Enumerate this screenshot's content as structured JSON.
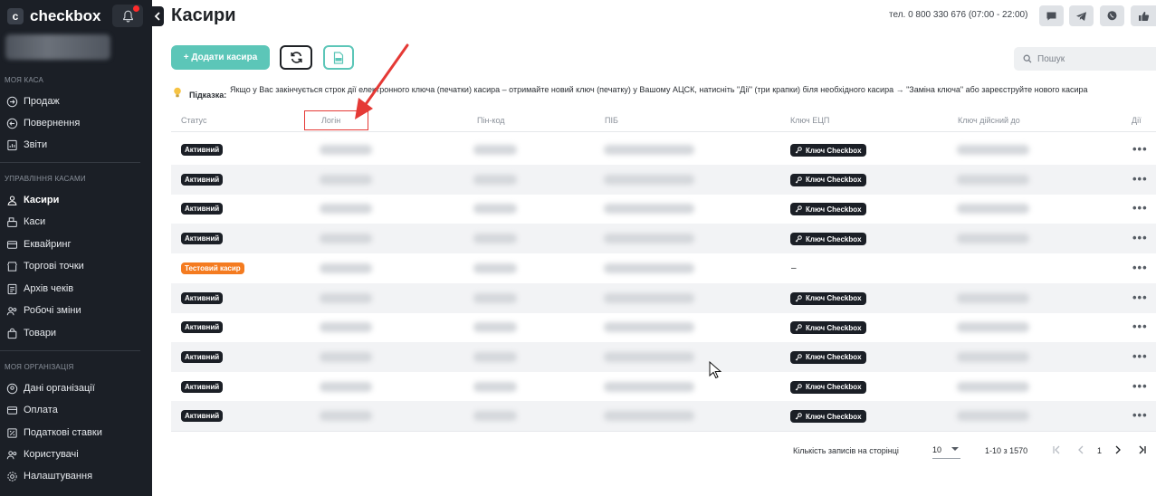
{
  "brand": {
    "name": "checkbox",
    "mark": "c"
  },
  "sidebar": {
    "sections": [
      {
        "title": "МОЯ КАСА",
        "items": [
          {
            "label": "Продаж",
            "icon": "arrow-right-circle-icon"
          },
          {
            "label": "Повернення",
            "icon": "arrow-left-circle-icon"
          },
          {
            "label": "Звіти",
            "icon": "report-icon"
          }
        ]
      },
      {
        "title": "УПРАВЛІННЯ КАСАМИ",
        "items": [
          {
            "label": "Касири",
            "icon": "cashiers-icon",
            "active": true
          },
          {
            "label": "Каси",
            "icon": "cash-register-icon"
          },
          {
            "label": "Еквайринг",
            "icon": "acquiring-icon"
          },
          {
            "label": "Торгові точки",
            "icon": "shop-icon"
          },
          {
            "label": "Архів чеків",
            "icon": "archive-icon"
          },
          {
            "label": "Робочі зміни",
            "icon": "shifts-icon"
          },
          {
            "label": "Товари",
            "icon": "bag-icon"
          }
        ]
      },
      {
        "title": "МОЯ ОРГАНІЗАЦІЯ",
        "items": [
          {
            "label": "Дані організації",
            "icon": "organization-icon"
          },
          {
            "label": "Оплата",
            "icon": "payment-icon"
          },
          {
            "label": "Податкові ставки",
            "icon": "tax-icon"
          },
          {
            "label": "Користувачі",
            "icon": "users-icon"
          },
          {
            "label": "Налаштування",
            "icon": "settings-icon"
          }
        ]
      }
    ]
  },
  "header": {
    "title": "Касири",
    "phone": "тел. 0 800 330 676 (07:00 - 22:00)",
    "icons": [
      "chat-icon",
      "telegram-icon",
      "viber-icon",
      "thumbs-up-icon"
    ]
  },
  "toolbar": {
    "add_label": "+ Додати касира",
    "search_placeholder": "Пошук"
  },
  "hint": {
    "label": "Підказка:",
    "text": "Якщо у Вас закінчується строк дії електронного ключа (печатки) касира – отримайте новий ключ (печатку) у Вашому АЦСК, натисніть \"Дії\" (три крапки) біля необхідного касира → \"Заміна ключа\" або зареєструйте нового касира"
  },
  "table": {
    "columns": [
      "Статус",
      "Логін",
      "Пін-код",
      "ПІБ",
      "Ключ ЕЦП",
      "Ключ дійсний до",
      "Дії"
    ],
    "rows": [
      {
        "status": "Активний",
        "status_type": "active",
        "key": "Ключ Checkbox"
      },
      {
        "status": "Активний",
        "status_type": "active",
        "key": "Ключ Checkbox"
      },
      {
        "status": "Активний",
        "status_type": "active",
        "key": "Ключ Checkbox"
      },
      {
        "status": "Активний",
        "status_type": "active",
        "key": "Ключ Checkbox"
      },
      {
        "status": "Тестовий касир",
        "status_type": "test",
        "key": "–"
      },
      {
        "status": "Активний",
        "status_type": "active",
        "key": "Ключ Checkbox"
      },
      {
        "status": "Активний",
        "status_type": "active",
        "key": "Ключ Checkbox"
      },
      {
        "status": "Активний",
        "status_type": "active",
        "key": "Ключ Checkbox"
      },
      {
        "status": "Активний",
        "status_type": "active",
        "key": "Ключ Checkbox"
      },
      {
        "status": "Активний",
        "status_type": "active",
        "key": "Ключ Checkbox"
      }
    ],
    "actions_symbol": "•••"
  },
  "pagination": {
    "per_page_label": "Кількість записів на сторінці",
    "per_page_value": "10",
    "range": "1-10 з 1570",
    "current_page": "1"
  },
  "colors": {
    "accent": "#5cc6b8",
    "sidebar_bg": "#1b1f26",
    "active_badge": "#1b1f26",
    "test_badge": "#f47b20",
    "annotation": "#e53935"
  }
}
